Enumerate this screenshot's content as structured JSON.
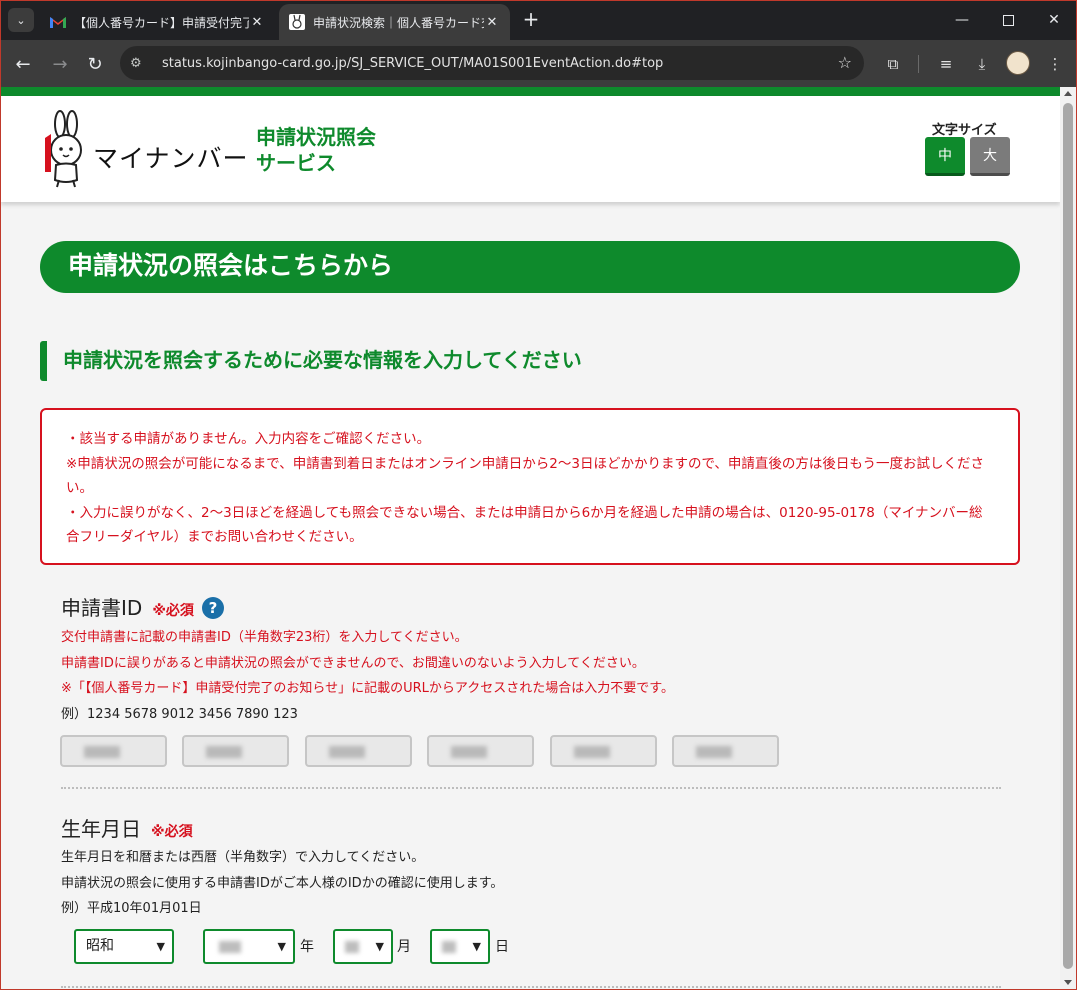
{
  "browser": {
    "tabs": [
      {
        "title": "【個人番号カード】申請受付完了の",
        "favicon": "gmail-icon",
        "active": false
      },
      {
        "title": "申請状況検索｜個人番号カード交",
        "favicon": "mynumber-mascot-icon",
        "active": true
      }
    ],
    "address": "status.kojinbango-card.go.jp/SJ_SERVICE_OUT/MA01S001EventAction.do#top"
  },
  "header": {
    "logo_text": "マイナンバー",
    "service_line1": "申請状況照会",
    "service_line2": "サービス",
    "font_size_label": "文字サイズ",
    "font_size_medium": "中",
    "font_size_large": "大"
  },
  "hero_title": "申請状況の照会はこちらから",
  "section_title": "申請状況を照会するために必要な情報を入力してください",
  "error_messages": [
    "・該当する申請がありません。入力内容をご確認ください。",
    "※申請状況の照会が可能になるまで、申請書到着日またはオンライン申請日から2～3日ほどかかりますので、申請直後の方は後日もう一度お試しください。",
    "・入力に誤りがなく、2～3日ほどを経過しても照会できない場合、または申請日から6か月を経過した申請の場合は、0120-95-0178（マイナンバー総合フリーダイヤル）までお問い合わせください。"
  ],
  "application_id": {
    "title": "申請書ID",
    "required": "※必須",
    "help": "?",
    "notes": [
      "交付申請書に記載の申請書ID（半角数字23桁）を入力してください。",
      "申請書IDに誤りがあると申請状況の照会ができませんので、お間違いのないよう入力してください。",
      "※「【個人番号カード】申請受付完了のお知らせ」に記載のURLからアクセスされた場合は入力不要です。"
    ],
    "example": "例）1234 5678 9012 3456 7890 123"
  },
  "birth_date": {
    "title": "生年月日",
    "required": "※必須",
    "notes": [
      "生年月日を和暦または西暦（半角数字）で入力してください。",
      "申請状況の照会に使用する申請書IDがご本人様のIDかの確認に使用します。"
    ],
    "example": "例）平成10年01月01日",
    "era_selected": "昭和",
    "year_unit": "年",
    "month_unit": "月",
    "day_unit": "日"
  }
}
